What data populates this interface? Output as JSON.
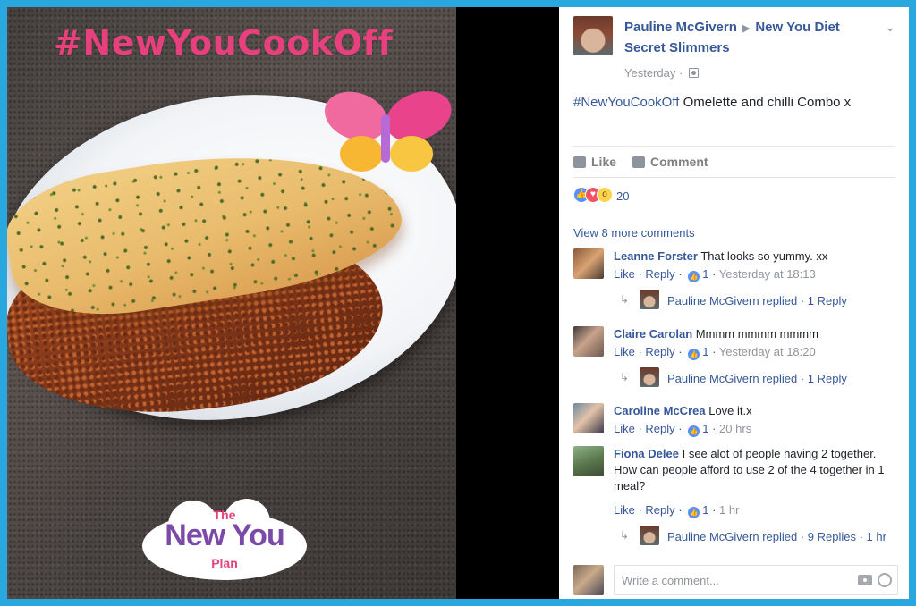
{
  "photo": {
    "hashtag": "#NewYouCookOff",
    "logo": {
      "the": "The",
      "brand": "New You",
      "plan": "Plan"
    },
    "colors": {
      "hashtag": "#e6407d",
      "logo_purple": "#7b4aa8",
      "frame": "#29a8df"
    }
  },
  "post": {
    "author": "Pauline McGivern",
    "group": "New You Diet Secret Slimmers",
    "timestamp": "Yesterday",
    "hashtag": "#NewYouCookOff",
    "text": " Omelette and chilli Combo x",
    "actions": {
      "like": "Like",
      "comment": "Comment"
    },
    "reactions": {
      "icons": [
        "like-icon",
        "love-icon",
        "wow-icon"
      ],
      "count": "20"
    },
    "view_more": "View 8 more comments"
  },
  "comments": [
    {
      "name": "Leanne Forster",
      "text": "That looks so yummy. xx",
      "like": "Like",
      "reply": "Reply",
      "likes": "1",
      "time": "Yesterday at 18:13",
      "reply_summary": "Pauline McGivern replied · 1 Reply"
    },
    {
      "name": "Claire Carolan",
      "text": "Mmmm mmmm mmmm",
      "like": "Like",
      "reply": "Reply",
      "likes": "1",
      "time": "Yesterday at 18:20",
      "reply_summary": "Pauline McGivern replied · 1 Reply"
    },
    {
      "name": "Caroline McCrea",
      "text": "Love it.x",
      "like": "Like",
      "reply": "Reply",
      "likes": "1",
      "time": "20 hrs"
    },
    {
      "name": "Fiona Delee",
      "text": "I see alot of people having 2 together. How can people afford to use 2 of the 4 together in 1 meal?",
      "like": "Like",
      "reply": "Reply",
      "likes": "1",
      "time": "1 hr",
      "reply_summary": "Pauline McGivern replied · 9 Replies · 1 hr"
    }
  ],
  "composer": {
    "placeholder": "Write a comment..."
  }
}
